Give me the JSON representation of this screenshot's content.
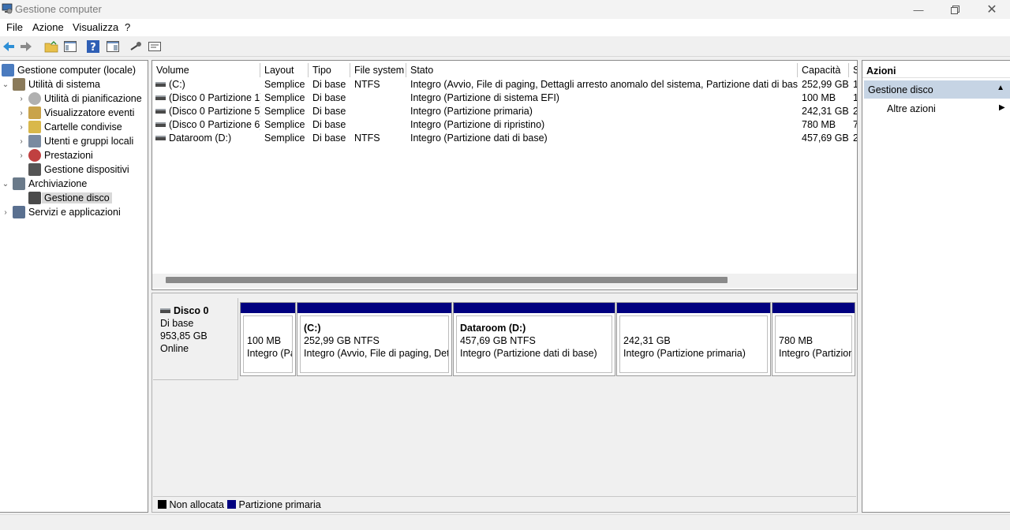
{
  "window": {
    "title": "Gestione computer"
  },
  "menu": [
    "File",
    "Azione",
    "Visualizza",
    "?"
  ],
  "toolbar": {
    "icons": [
      "back-arrow-icon",
      "forward-arrow-icon",
      "folder-up-icon",
      "show-hide-tree-icon",
      "help-icon",
      "properties-pane-icon",
      "connect-icon",
      "settings-list-icon"
    ]
  },
  "tree": {
    "items": [
      {
        "label": "Gestione computer (locale)",
        "level": 0,
        "expander": "",
        "icon": "computer-management-icon"
      },
      {
        "label": "Utilità di sistema",
        "level": 1,
        "expander": "⌄",
        "icon": "system-tools-icon"
      },
      {
        "label": "Utilità di pianificazione",
        "level": 2,
        "expander": "›",
        "icon": "clock-icon"
      },
      {
        "label": "Visualizzatore eventi",
        "level": 2,
        "expander": "›",
        "icon": "event-viewer-icon"
      },
      {
        "label": "Cartelle condivise",
        "level": 2,
        "expander": "›",
        "icon": "shared-folders-icon"
      },
      {
        "label": "Utenti e gruppi locali",
        "level": 2,
        "expander": "›",
        "icon": "users-icon"
      },
      {
        "label": "Prestazioni",
        "level": 2,
        "expander": "›",
        "icon": "performance-icon"
      },
      {
        "label": "Gestione dispositivi",
        "level": 2,
        "expander": "",
        "icon": "device-manager-icon"
      },
      {
        "label": "Archiviazione",
        "level": 1,
        "expander": "⌄",
        "icon": "storage-icon"
      },
      {
        "label": "Gestione disco",
        "level": 2,
        "expander": "",
        "icon": "disk-management-icon",
        "selected": true
      },
      {
        "label": "Servizi e applicazioni",
        "level": 1,
        "expander": "›",
        "icon": "services-icon"
      }
    ]
  },
  "volumes": {
    "columns": [
      "Volume",
      "Layout",
      "Tipo",
      "File system",
      "Stato",
      "Capacità",
      "S"
    ],
    "rows": [
      [
        "(C:)",
        "Semplice",
        "Di base",
        "NTFS",
        "Integro (Avvio, File di paging, Dettagli arresto anomalo del sistema, Partizione dati di base)",
        "252,99 GB",
        "1"
      ],
      [
        "(Disco 0 Partizione 1)",
        "Semplice",
        "Di base",
        "",
        "Integro (Partizione di sistema EFI)",
        "100 MB",
        "1"
      ],
      [
        "(Disco 0 Partizione 5)",
        "Semplice",
        "Di base",
        "",
        "Integro (Partizione primaria)",
        "242,31 GB",
        "2"
      ],
      [
        "(Disco 0 Partizione 6)",
        "Semplice",
        "Di base",
        "",
        "Integro (Partizione di ripristino)",
        "780 MB",
        "7"
      ],
      [
        "Dataroom (D:)",
        "Semplice",
        "Di base",
        "NTFS",
        "Integro (Partizione dati di base)",
        "457,69 GB",
        "2"
      ]
    ]
  },
  "disk": {
    "name": "Disco 0",
    "type": "Di base",
    "size": "953,85 GB",
    "status": "Online",
    "partitions": [
      {
        "name": "",
        "size": "100 MB",
        "status": "Integro (Pa"
      },
      {
        "name": "(C:)",
        "size": "252,99 GB NTFS",
        "status": "Integro (Avvio, File di paging, Dett"
      },
      {
        "name": "Dataroom  (D:)",
        "size": "457,69 GB NTFS",
        "status": "Integro (Partizione dati di base)"
      },
      {
        "name": "",
        "size": "242,31 GB",
        "status": "Integro (Partizione primaria)"
      },
      {
        "name": "",
        "size": "780 MB",
        "status": "Integro (Partizion"
      }
    ]
  },
  "legend": [
    {
      "label": "Non allocata",
      "color": "#000000"
    },
    {
      "label": "Partizione primaria",
      "color": "#00007f"
    }
  ],
  "actions": {
    "title": "Azioni",
    "selected": "Gestione disco",
    "more": "Altre azioni"
  },
  "colors": {
    "partition_bar": "#00007f",
    "actions_selected": "#c6d4e4",
    "tree_selected": "#d9d9d9"
  }
}
